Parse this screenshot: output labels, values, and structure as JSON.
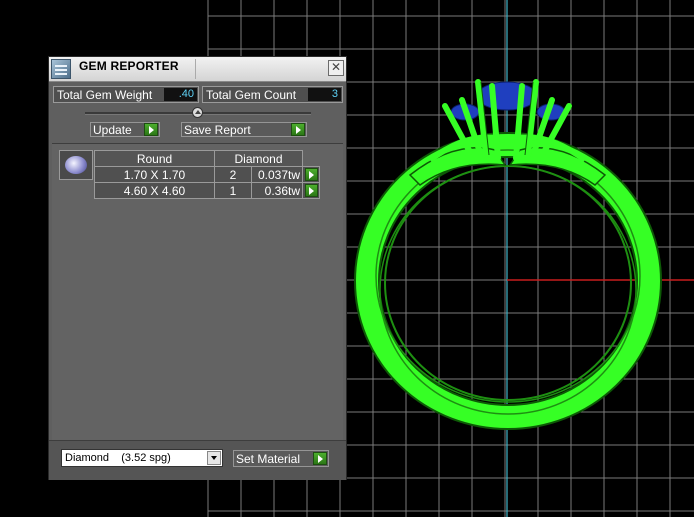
{
  "panel": {
    "title": "GEM REPORTER",
    "close_glyph": "✕",
    "total_weight_label": "Total Gem Weight",
    "total_weight_value": ".40",
    "total_count_label": "Total Gem Count",
    "total_count_value": "3",
    "update_label": "Update",
    "save_report_label": "Save Report",
    "table": {
      "headers": [
        "Round",
        "Diamond"
      ],
      "rows": [
        {
          "size": "1.70 X 1.70",
          "qty": "2",
          "weight": "0.037tw"
        },
        {
          "size": "4.60 X 4.60",
          "qty": "1",
          "weight": "0.36tw"
        }
      ]
    },
    "material_select": "Diamond    (3.52 spg)",
    "set_material_label": "Set Material"
  },
  "colors": {
    "metal": "#33ff22",
    "gem": "#1f3fbf",
    "grid": "#7a7a7a",
    "axis_y": "#3fb5c9",
    "axis_x": "#c81e1e",
    "value_text": "#5fd3f7"
  },
  "icons": {
    "title": "gem-reporter-icon",
    "close": "close-icon",
    "go": "green-arrow-icon",
    "dropdown": "chevron-down-icon"
  }
}
